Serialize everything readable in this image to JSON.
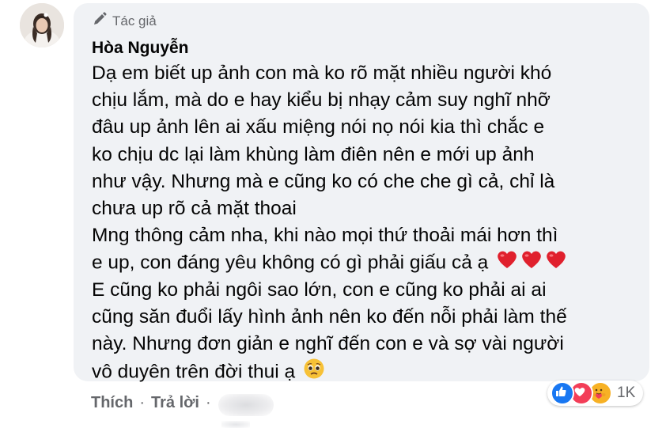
{
  "comment": {
    "author_badge": "Tác giả",
    "author_name": "Hòa Nguyễn",
    "lines": [
      "Dạ em biết up ảnh con mà ko rõ mặt nhiều người khó",
      "chịu lắm, mà do e hay kiểu bị nhạy cảm suy nghĩ nhỡ",
      "đâu up ảnh lên ai xấu miệng nói nọ nói kia thì chắc e",
      "ko chịu dc lại làm khùng làm điên nên e mới up ảnh",
      "như vậy. Nhưng mà e cũng ko có che che gì cả, chỉ là",
      "chưa up rõ cả mặt thoai",
      "Mng thông cảm nha, khi nào mọi thứ thoải mái hơn thì",
      "e up, con đáng yêu không có gì phải giấu cả ạ",
      "E cũng ko phải ngôi sao lớn, con e cũng ko phải ai ai",
      "cũng săn đuổi lấy hình ảnh nên ko đến nỗi phải làm thế",
      "này. Nhưng đơn giản e nghĩ đến con e và sợ vài người",
      "vô duyên trên đời thui ạ"
    ],
    "emojis": {
      "line_8": [
        "red-heart",
        "red-heart",
        "red-heart"
      ],
      "line_12": [
        "pleading-face"
      ]
    }
  },
  "reactions": {
    "types": [
      "like",
      "love",
      "care"
    ],
    "count": "1K"
  },
  "actions": {
    "like_label": "Thích",
    "separator": "·",
    "reply_label": "Trả lời",
    "separator2": "·"
  },
  "colors": {
    "bubble": "#f0f2f5",
    "secondary_text": "#65676b",
    "like_blue": "#1877f2",
    "love_red": "#f33e58",
    "care_yellow": "#f7b125"
  }
}
